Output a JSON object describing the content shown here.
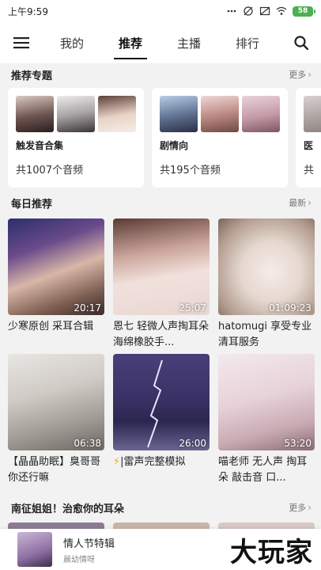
{
  "status_bar": {
    "time": "上午9:59",
    "battery": "58"
  },
  "nav": {
    "tabs": [
      "我的",
      "推荐",
      "主播",
      "排行"
    ],
    "active_tab": "推荐"
  },
  "section_topics": {
    "title": "推荐专题",
    "more": "更多",
    "cards": [
      {
        "name": "触发音合集",
        "count": "共1007个音频"
      },
      {
        "name": "剧情向",
        "count": "共195个音频"
      },
      {
        "name": "医",
        "count": "共"
      }
    ]
  },
  "section_daily": {
    "title": "每日推荐",
    "more": "最新",
    "items": [
      {
        "title": "少寒原创 采耳合辑",
        "duration": "20:17"
      },
      {
        "title": "恩七 轻微人声掏耳朵海绵橡胶手...",
        "duration": "25:07"
      },
      {
        "title": "hatomugi 享受专业清耳服务",
        "duration": "01:09:23"
      },
      {
        "title": "【晶晶助眠】臭哥哥你还行嘛",
        "duration": "06:38"
      },
      {
        "title": "|雷声完整模拟",
        "duration": "26:00"
      },
      {
        "title": "喵老师 无人声 掏耳朵 敲击音 口...",
        "duration": "53:20"
      }
    ]
  },
  "section_next": {
    "title": "南征姐姐！治愈你的耳朵",
    "more": "更多"
  },
  "player": {
    "title": "情人节特辑",
    "subtitle": "晨幼情呀"
  },
  "watermark": "大玩家",
  "colors": {
    "battery": "#4caf50",
    "bolt": "#f5a623",
    "background": "#f2f2f2"
  }
}
